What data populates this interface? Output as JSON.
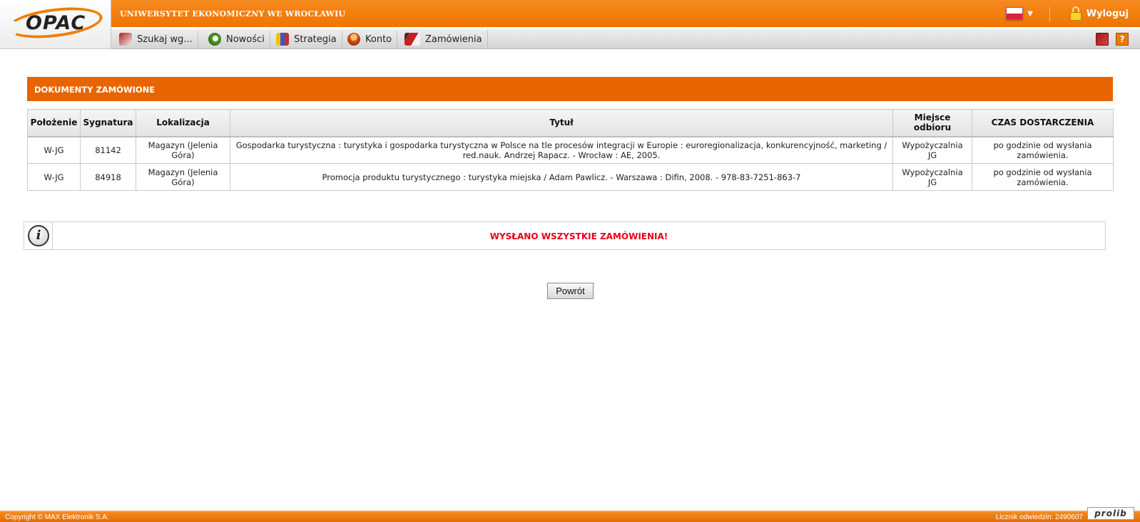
{
  "header": {
    "logo_text": "OPAC",
    "university": "UNIWERSYTET EKONOMICZNY WE WROCŁAWIU",
    "lang_arrow": "▼",
    "logout_label": "Wyloguj"
  },
  "nav": {
    "items": [
      {
        "label": "Szukaj wg...",
        "icon": "search-book-icon"
      },
      {
        "label": "Nowości",
        "icon": "magnifier-icon"
      },
      {
        "label": "Strategia",
        "icon": "books-icon"
      },
      {
        "label": "Konto",
        "icon": "user-icon"
      },
      {
        "label": "Zamówienia",
        "icon": "orders-icon"
      }
    ],
    "help_label": "?"
  },
  "section": {
    "title": "DOKUMENTY ZAMÓWIONE"
  },
  "table": {
    "headers": [
      "Położenie",
      "Sygnatura",
      "Lokalizacja",
      "Tytuł",
      "Miejsce odbioru",
      "CZAS DOSTARCZENIA"
    ],
    "rows": [
      {
        "polozenie": "W-JG",
        "sygnatura": "81142",
        "lokalizacja": "Magazyn (Jelenia Góra)",
        "tytul": "Gospodarka turystyczna : turystyka i gospodarka turystyczna w Polsce na tle procesów integracji w Europie : euroregionalizacja, konkurencyjność, marketing / red.nauk. Andrzej Rapacz. - Wrocław : AE, 2005.",
        "miejsce": "Wypożyczalnia JG",
        "czas": "po godzinie od wysłania zamówienia."
      },
      {
        "polozenie": "W-JG",
        "sygnatura": "84918",
        "lokalizacja": "Magazyn (Jelenia Góra)",
        "tytul": "Promocja produktu turystycznego : turystyka miejska / Adam Pawlicz. - Warszawa : Difin, 2008. - 978-83-7251-863-7",
        "miejsce": "Wypożyczalnia JG",
        "czas": "po godzinie od wysłania zamówienia."
      }
    ]
  },
  "info": {
    "icon_glyph": "i",
    "message": "WYSŁANO WSZYSTKIE ZAMÓWIENIA!"
  },
  "actions": {
    "back_label": "Powrót"
  },
  "footer": {
    "copyright": "Copyright © MAX Elektronik S.A.",
    "counter": "Licznik odwiedzin: 2490607",
    "brand": "prolib"
  },
  "colors": {
    "accent": "#ef7400",
    "section": "#e86400",
    "message": "#e8001c"
  }
}
